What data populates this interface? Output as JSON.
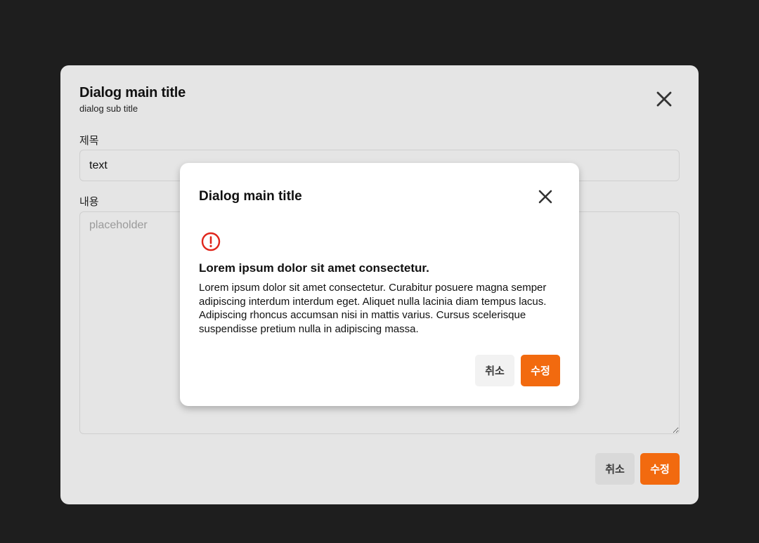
{
  "outer_dialog": {
    "title": "Dialog main title",
    "subtitle": "dialog sub title",
    "fields": {
      "title_label": "제목",
      "title_value": "text",
      "content_label": "내용",
      "content_placeholder": "placeholder"
    },
    "buttons": {
      "cancel": "취소",
      "confirm": "수정"
    }
  },
  "inner_dialog": {
    "title": "Dialog main title",
    "alert_icon": "exclamation-circle-icon",
    "heading": "Lorem ipsum dolor sit amet consectetur.",
    "body": "Lorem ipsum dolor sit amet consectetur. Curabitur posuere magna semper adipiscing interdum interdum eget. Aliquet nulla lacinia diam tempus lacus. Adipiscing rhoncus accumsan nisi in mattis varius. Cursus scelerisque suspendisse pretium nulla in adipiscing massa.",
    "buttons": {
      "cancel": "취소",
      "confirm": "수정"
    }
  },
  "colors": {
    "accent": "#f26a0f",
    "alert": "#e0261b",
    "backdrop": "#1e1e1e"
  }
}
